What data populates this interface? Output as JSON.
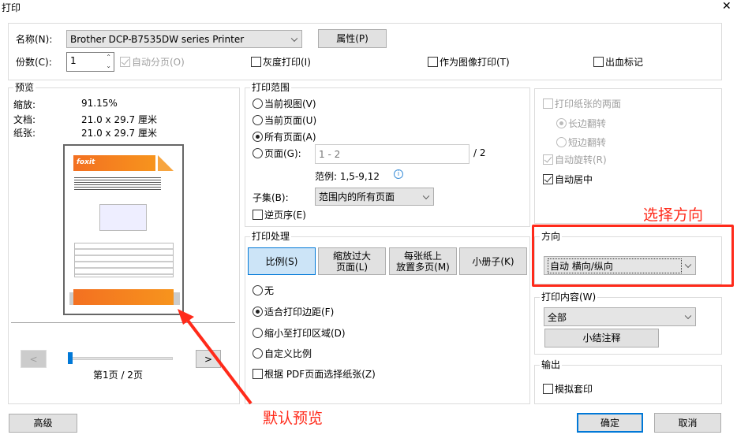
{
  "window": {
    "title": "打印",
    "close": "✕"
  },
  "printer": {
    "name_label": "名称(N):",
    "name_value": "Brother DCP-B7535DW series Printer",
    "properties": "属性(P)",
    "copies_label": "份数(C):",
    "copies_value": "1",
    "collate": "自动分页(O)",
    "grayscale": "灰度打印(I)",
    "as_image": "作为图像打印(T)",
    "bleed": "出血标记"
  },
  "preview": {
    "title": "预览",
    "zoom_label": "缩放:",
    "zoom_value": "91.15%",
    "doc_label": "文档:",
    "doc_value": "21.0 x 29.7 厘米",
    "paper_label": "纸张:",
    "paper_value": "21.0 x 29.7 厘米",
    "thumb_logo": "Foxit",
    "prev": "<",
    "next": ">",
    "page_label": "第1页 / 2页",
    "slider_fraction": 0
  },
  "range": {
    "title": "打印范围",
    "current_view": "当前视图(V)",
    "current_page": "当前页面(U)",
    "all_pages": "所有页面(A)",
    "pages": "页面(G):",
    "pages_placeholder": "1 - 2",
    "total": "/ 2",
    "example": "范例: 1,5-9,12",
    "subset_label": "子集(B):",
    "subset_value": "范围内的所有页面",
    "reverse": "逆页序(E)"
  },
  "handling": {
    "title": "打印处理",
    "tabs": [
      "比例(S)",
      "缩放过大\n页面(L)",
      "每张纸上\n放置多页(M)",
      "小册子(K)"
    ],
    "none": "无",
    "fit_margins": "适合打印边距(F)",
    "shrink": "缩小至打印区域(D)",
    "custom": "自定义比例",
    "by_pdf": "根据 PDF页面选择纸张(Z)"
  },
  "duplex": {
    "both_sides": "打印纸张的两面",
    "long_edge": "长边翻转",
    "short_edge": "短边翻转",
    "auto_rotate": "自动旋转(R)",
    "auto_center": "自动居中"
  },
  "orientation": {
    "title": "方向",
    "value": "自动 横向/纵向"
  },
  "content": {
    "title": "打印内容(W)",
    "value": "全部",
    "summary": "小结注释"
  },
  "output": {
    "title": "输出",
    "simulate": "模拟套印"
  },
  "buttons": {
    "advanced": "高级",
    "ok": "确定",
    "cancel": "取消"
  },
  "annotations": {
    "orientation_note": "选择方向",
    "preview_note": "默认预览",
    "color": "#ff2a1a"
  }
}
